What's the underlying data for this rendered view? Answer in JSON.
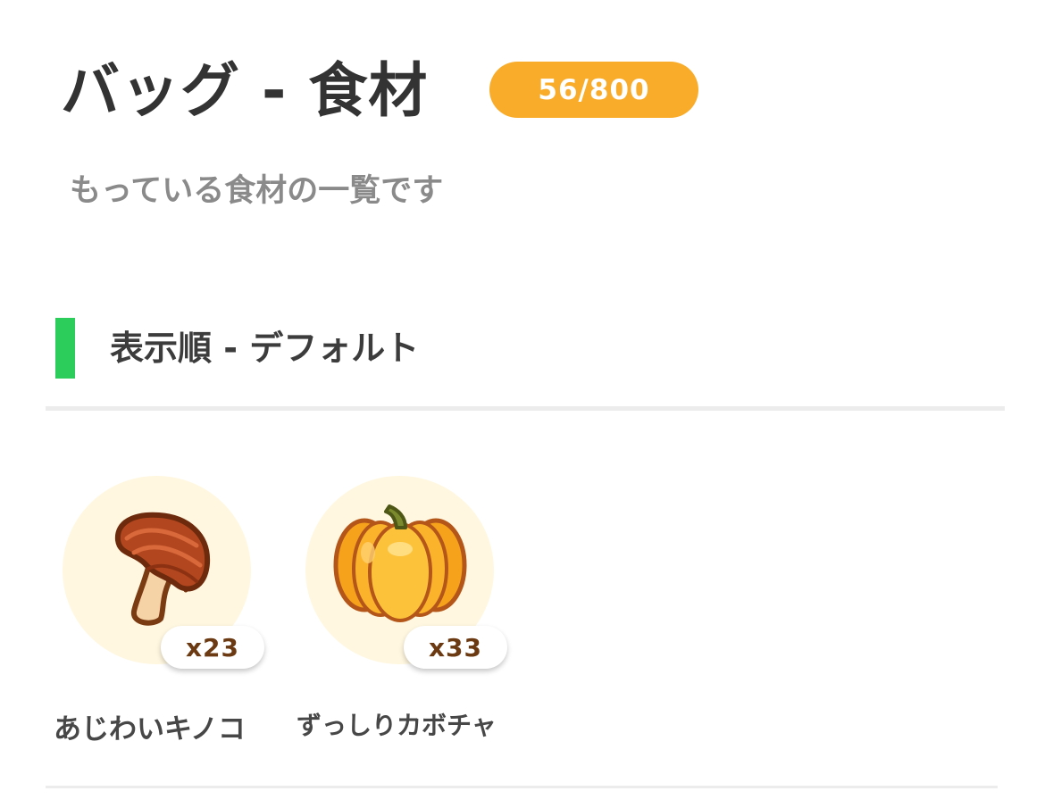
{
  "header": {
    "title": "バッグ - 食材",
    "capacity": "56/800",
    "subtitle": "もっている食材の一覧です"
  },
  "sort": {
    "label": "表示順 - デフォルト"
  },
  "colors": {
    "capacity_badge": "#f9ac2a",
    "sort_accent": "#2ccd5a",
    "item_circle": "#fff7df",
    "count_text": "#6b3a12"
  },
  "items": [
    {
      "name": "あじわいキノコ",
      "count": "x23",
      "icon": "mushroom-icon"
    },
    {
      "name": "ずっしりカボチャ",
      "count": "x33",
      "icon": "pumpkin-icon"
    }
  ]
}
